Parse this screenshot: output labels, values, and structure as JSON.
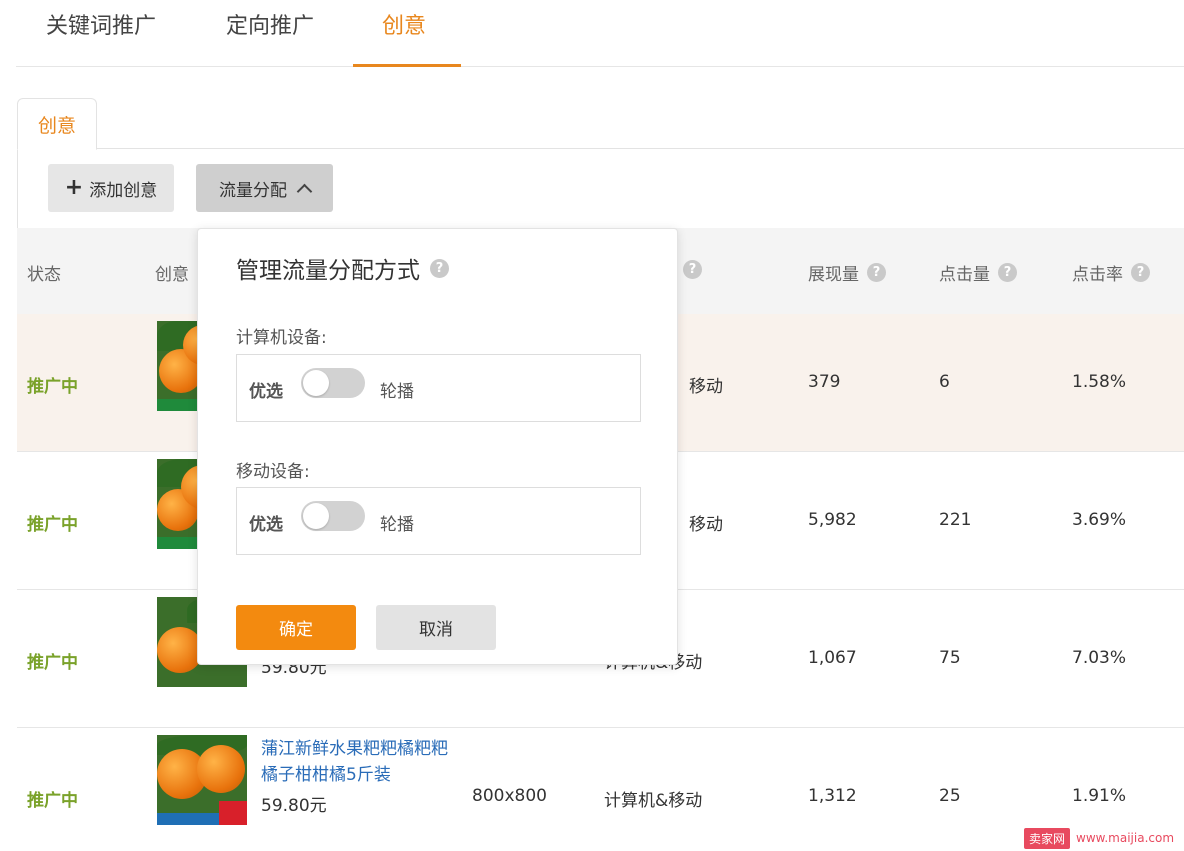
{
  "top_tabs": [
    "关键词推广",
    "定向推广",
    "创意"
  ],
  "sub_tab": "创意",
  "toolbar": {
    "add_label": "添加创意",
    "flow_label": "流量分配"
  },
  "table": {
    "headers": {
      "status": "状态",
      "creative": "创意",
      "impressions": "展现量",
      "clicks": "点击量",
      "ctr": "点击率"
    },
    "rows": [
      {
        "status": "推广中",
        "title": "",
        "price": "",
        "size": "",
        "device": "移动",
        "impressions": "379",
        "clicks": "6",
        "ctr": "1.58%"
      },
      {
        "status": "推广中",
        "title": "",
        "price": "",
        "size": "",
        "device": "移动",
        "impressions": "5,982",
        "clicks": "221",
        "ctr": "3.69%"
      },
      {
        "status": "推广中",
        "title": "",
        "price": "59.80元",
        "size": "",
        "device": "计算机&移动",
        "impressions": "1,067",
        "clicks": "75",
        "ctr": "7.03%"
      },
      {
        "status": "推广中",
        "title": "蒲江新鲜水果粑粑橘粑粑橘子柑柑橘5斤装",
        "price": "59.80元",
        "size": "800x800",
        "device": "计算机&移动",
        "impressions": "1,312",
        "clicks": "25",
        "ctr": "1.91%"
      }
    ]
  },
  "popup": {
    "title": "管理流量分配方式",
    "computer_label": "计算机设备:",
    "mobile_label": "移动设备:",
    "left_option": "优选",
    "right_option": "轮播",
    "ok_label": "确定",
    "cancel_label": "取消"
  },
  "watermark": {
    "badge": "卖家网",
    "url": "www.maijia.com"
  },
  "colors": {
    "accent": "#e8871e",
    "status_green": "#7aa22a",
    "link_blue": "#2a6cb8",
    "ok_orange": "#f38a0f"
  }
}
